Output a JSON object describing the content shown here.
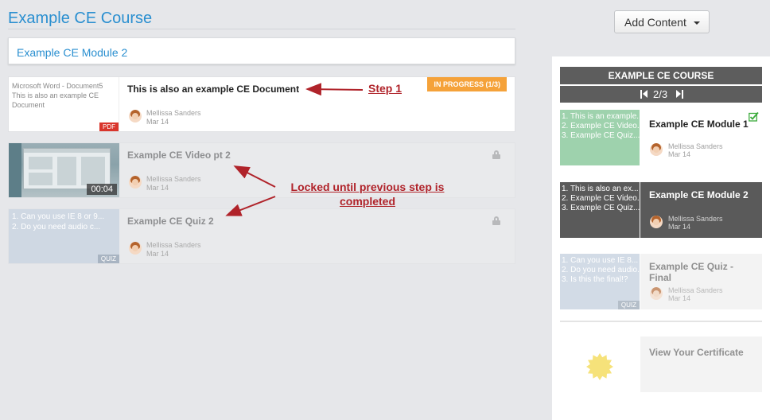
{
  "course": {
    "title": "Example CE Course"
  },
  "module": {
    "title": "Example CE Module 2"
  },
  "steps": [
    {
      "thumb_text": "Microsoft Word - Document5 This is also an example CE Document",
      "thumb_tag": "PDF",
      "title": "This is also an example CE Document",
      "author": "Mellissa Sanders",
      "date": "Mar 14",
      "badge": "IN PROGRESS (1/3)"
    },
    {
      "thumb_time": "00:04",
      "title": "Example CE Video pt 2",
      "author": "Mellissa Sanders",
      "date": "Mar 14"
    },
    {
      "thumb_lines": [
        "1. Can you use IE 8 or 9...",
        "2. Do you need audio c..."
      ],
      "thumb_tag": "QUIZ",
      "title": "Example CE Quiz 2",
      "author": "Mellissa Sanders",
      "date": "Mar 14"
    }
  ],
  "annotations": {
    "step1": "Step 1",
    "locked": "Locked until previous step is completed"
  },
  "toolbar": {
    "add_content_label": "Add Content"
  },
  "sidebar": {
    "header": "EXAMPLE CE COURSE",
    "pager": "2/3",
    "cards": [
      {
        "thumb_lines": [
          "1. This is an example...",
          "2. Example CE Video...",
          "3. Example CE Quiz..."
        ],
        "title": "Example CE Module 1",
        "author": "Mellissa Sanders",
        "date": "Mar 14"
      },
      {
        "thumb_lines": [
          "1. This is also an ex...",
          "2. Example CE Video...",
          "3. Example CE Quiz..."
        ],
        "title": "Example CE Module 2",
        "author": "Mellissa Sanders",
        "date": "Mar 14"
      },
      {
        "thumb_lines": [
          "1. Can you use IE 8...",
          "2. Do you need audio...",
          "3. Is this the final!?"
        ],
        "thumb_tag": "QUIZ",
        "title": "Example CE Quiz - Final",
        "author": "Mellissa Sanders",
        "date": "Mar 14"
      },
      {
        "title": "View Your Certificate"
      }
    ]
  },
  "colors": {
    "link_blue": "#2a8fd0",
    "progress_orange": "#f5a23a",
    "annotation_red": "#b0232a",
    "complete_green": "#3cab3c"
  }
}
